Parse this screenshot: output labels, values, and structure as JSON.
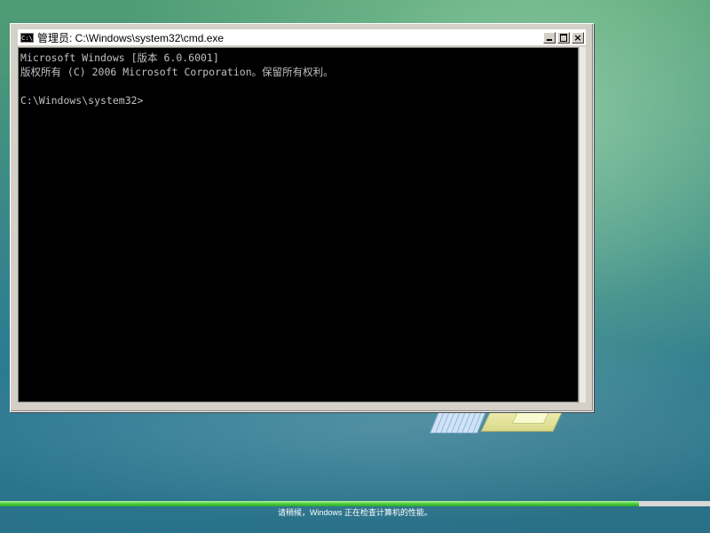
{
  "window": {
    "title": "管理员: C:\\Windows\\system32\\cmd.exe",
    "icon_text": "C:\\",
    "minimize_label": "",
    "close_label": "×"
  },
  "console": {
    "lines": [
      "Microsoft Windows [版本 6.0.6001]",
      "版权所有 (C) 2006 Microsoft Corporation。保留所有权利。",
      "",
      "C:\\Windows\\system32>"
    ]
  },
  "setup": {
    "status_text": "请稍候，Windows 正在检查计算机的性能。",
    "progress": 0.9
  },
  "colors": {
    "console_bg": "#000000",
    "console_fg": "#c0c0c0",
    "progress_fill": "#4cce3b"
  },
  "icons": {
    "cmd": "cmd-icon",
    "minimize": "minimize-icon",
    "maximize": "maximize-icon",
    "close": "close-icon"
  }
}
